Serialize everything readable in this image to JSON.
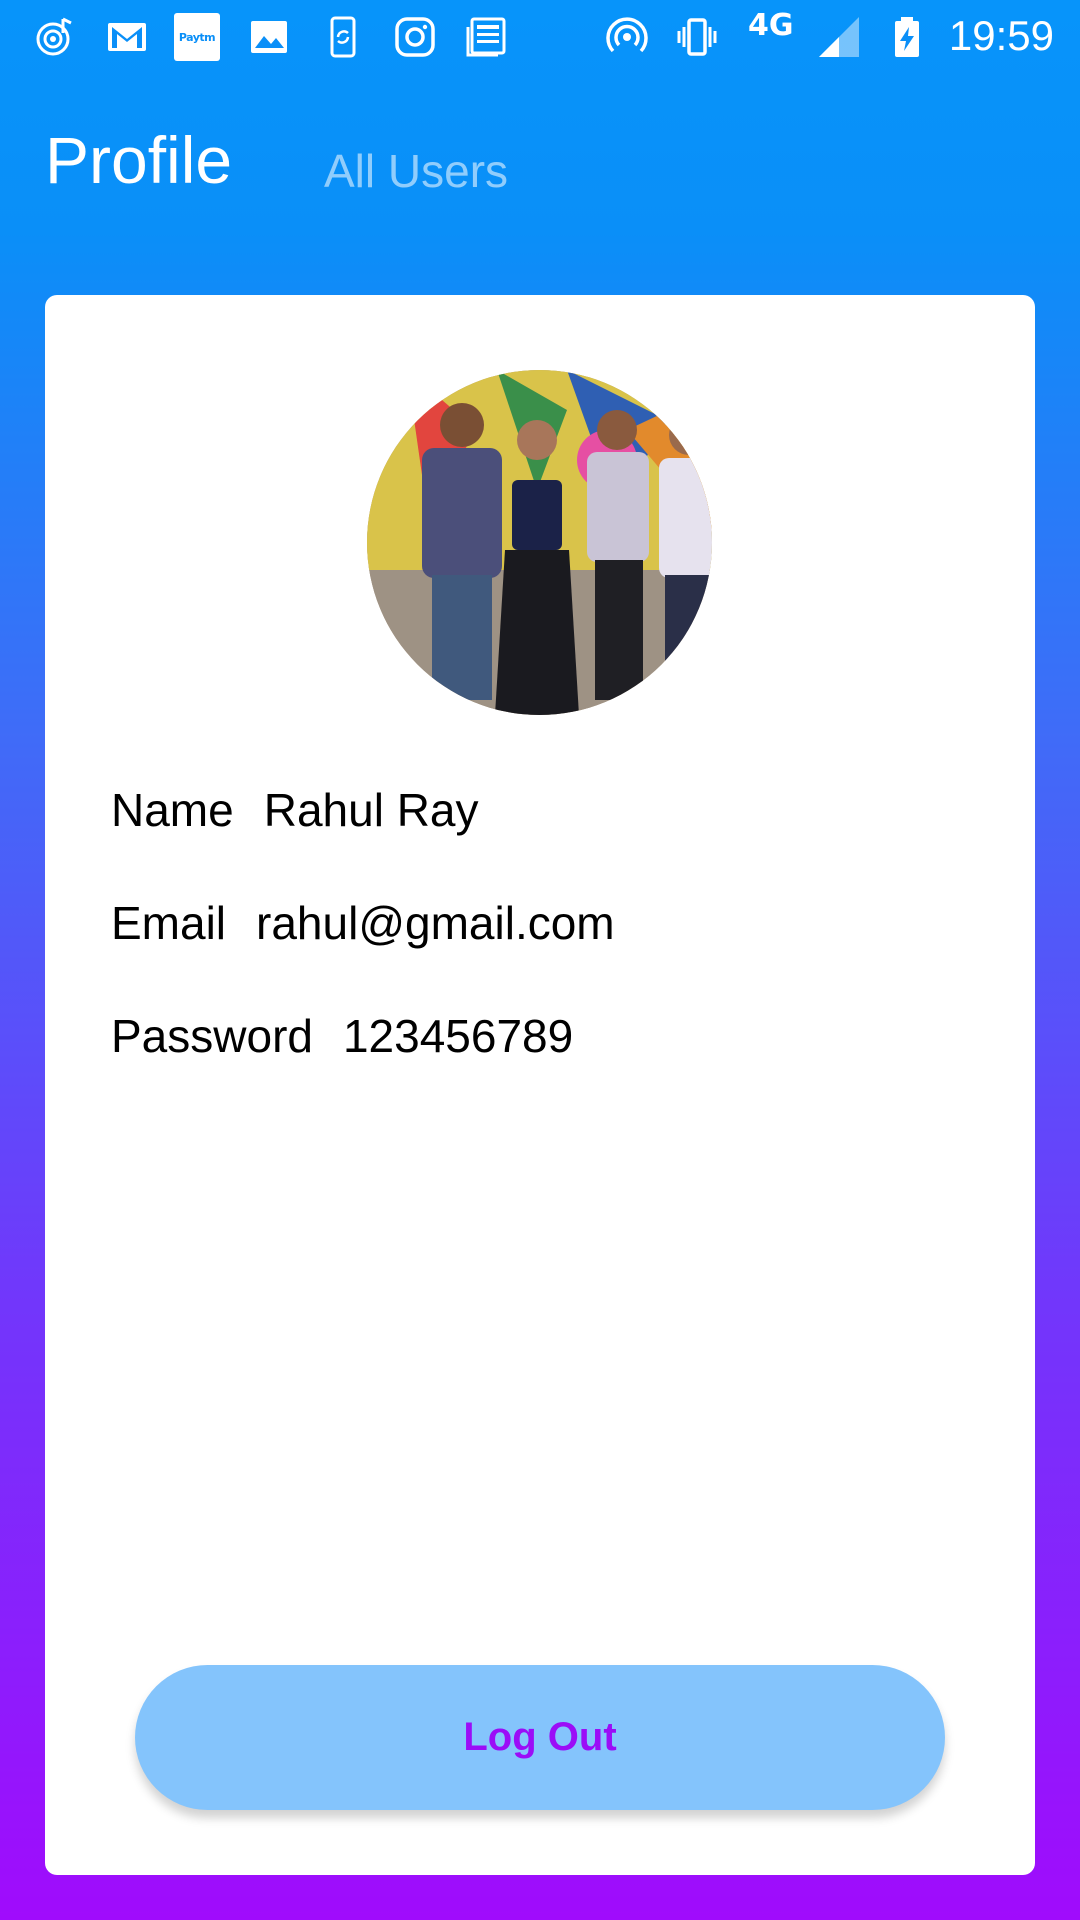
{
  "status_bar": {
    "icons": [
      "music-notification-icon",
      "gmail-icon",
      "paytm-icon",
      "gallery-icon",
      "phone-sync-icon",
      "instagram-icon",
      "news-icon",
      "hotspot-icon",
      "vibrate-icon",
      "signal-icon",
      "battery-charging-icon"
    ],
    "paytm_text": "Paytm",
    "network": "4G",
    "time": "19:59"
  },
  "tabs": [
    {
      "label": "Profile",
      "active": true
    },
    {
      "label": "All Users",
      "active": false
    }
  ],
  "profile": {
    "name_label": "Name",
    "name_value": "Rahul Ray",
    "email_label": "Email",
    "email_value": "rahul@gmail.com",
    "password_label": "Password",
    "password_value": "123456789"
  },
  "logout_button": {
    "label": "Log Out"
  },
  "colors": {
    "gradient_top": "#0794fa",
    "gradient_bottom": "#a00bfc",
    "button_bg": "#84c4fc",
    "button_text": "#9b0df7"
  }
}
